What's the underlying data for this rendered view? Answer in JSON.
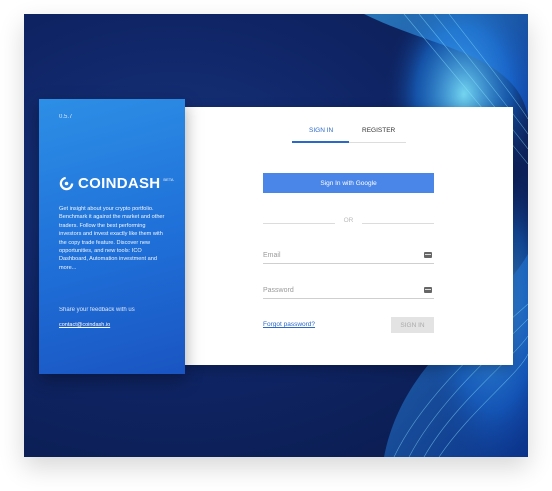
{
  "app": {
    "version": "0.5.7",
    "brand_name": "COINDASH",
    "beta": "BETA",
    "description": "Get insight about your crypto portfolio. Benchmark it against the market and other traders. Follow the best performing investors and invest exactly like them with the copy trade feature. Discover new opportunities, and new tools: ICO Dashboard, Automation investment and more...",
    "feedback_text": "Share your feedback with us",
    "contact_email": "contact@coindash.io"
  },
  "auth": {
    "tabs": [
      {
        "label": "SIGN IN",
        "active": true
      },
      {
        "label": "REGISTER",
        "active": false
      }
    ],
    "google_button": "Sign In with Google",
    "or_label": "OR",
    "email_placeholder": "Email",
    "password_placeholder": "Password",
    "forgot_password": "Forgot password?",
    "submit_label": "SIGN IN"
  },
  "icons": {
    "brand_logo": "coindash-logo-icon",
    "email_field": "keyboard-icon",
    "password_field": "keyboard-icon"
  },
  "colors": {
    "background_dark": "#0f2566",
    "brand_panel": "#1f6fd8",
    "accent": "#2b69c9",
    "google_button": "#4a86e8",
    "disabled_button": "#e3e3e3"
  }
}
